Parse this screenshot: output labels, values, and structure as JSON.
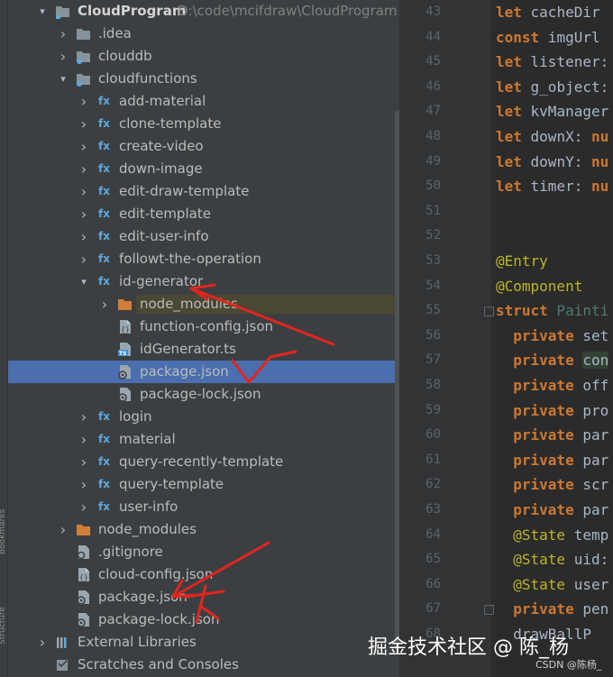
{
  "sidebar_stripe": {
    "labels": [
      "Bookmarks",
      "Structure"
    ]
  },
  "project": {
    "root": {
      "name": "CloudProgram",
      "path": "D:\\code\\mcifdraw\\CloudProgram"
    },
    "rows": [
      {
        "label": "CloudProgram",
        "depth": 0,
        "arrow": "open",
        "icon": "module-folder-icon"
      },
      {
        "label": ".idea",
        "depth": 1,
        "arrow": "closed",
        "icon": "folder-icon"
      },
      {
        "label": "clouddb",
        "depth": 1,
        "arrow": "closed",
        "icon": "db-folder-icon"
      },
      {
        "label": "cloudfunctions",
        "depth": 1,
        "arrow": "open",
        "icon": "db-folder-icon"
      },
      {
        "label": "add-material",
        "depth": 2,
        "arrow": "closed",
        "icon": "fx-icon"
      },
      {
        "label": "clone-template",
        "depth": 2,
        "arrow": "closed",
        "icon": "fx-icon"
      },
      {
        "label": "create-video",
        "depth": 2,
        "arrow": "closed",
        "icon": "fx-icon"
      },
      {
        "label": "down-image",
        "depth": 2,
        "arrow": "closed",
        "icon": "fx-icon"
      },
      {
        "label": "edit-draw-template",
        "depth": 2,
        "arrow": "closed",
        "icon": "fx-icon"
      },
      {
        "label": "edit-template",
        "depth": 2,
        "arrow": "closed",
        "icon": "fx-icon"
      },
      {
        "label": "edit-user-info",
        "depth": 2,
        "arrow": "closed",
        "icon": "fx-icon"
      },
      {
        "label": "followt-the-operation",
        "depth": 2,
        "arrow": "closed",
        "icon": "fx-icon"
      },
      {
        "label": "id-generator",
        "depth": 2,
        "arrow": "open",
        "icon": "fx-icon"
      },
      {
        "label": "node_modules",
        "depth": 3,
        "arrow": "closed",
        "icon": "orange-folder-icon",
        "highlight": true
      },
      {
        "label": "function-config.json",
        "depth": 3,
        "arrow": "none",
        "icon": "json-file-icon"
      },
      {
        "label": "idGenerator.ts",
        "depth": 3,
        "arrow": "none",
        "icon": "ts-file-icon"
      },
      {
        "label": "package.json",
        "depth": 3,
        "arrow": "none",
        "icon": "npm-file-icon",
        "selected": true
      },
      {
        "label": "package-lock.json",
        "depth": 3,
        "arrow": "none",
        "icon": "npm-file-icon"
      },
      {
        "label": "login",
        "depth": 2,
        "arrow": "closed",
        "icon": "fx-icon"
      },
      {
        "label": "material",
        "depth": 2,
        "arrow": "closed",
        "icon": "fx-icon"
      },
      {
        "label": "query-recently-template",
        "depth": 2,
        "arrow": "closed",
        "icon": "fx-icon"
      },
      {
        "label": "query-template",
        "depth": 2,
        "arrow": "closed",
        "icon": "fx-icon"
      },
      {
        "label": "user-info",
        "depth": 2,
        "arrow": "closed",
        "icon": "fx-icon"
      },
      {
        "label": "node_modules",
        "depth": 1,
        "arrow": "closed",
        "icon": "orange-folder-icon"
      },
      {
        "label": ".gitignore",
        "depth": 1,
        "arrow": "none",
        "icon": "text-file-icon"
      },
      {
        "label": "cloud-config.json",
        "depth": 1,
        "arrow": "none",
        "icon": "json-file-icon"
      },
      {
        "label": "package.json",
        "depth": 1,
        "arrow": "none",
        "icon": "npm-file-icon"
      },
      {
        "label": "package-lock.json",
        "depth": 1,
        "arrow": "none",
        "icon": "npm-file-icon"
      },
      {
        "label": "External Libraries",
        "depth": 0,
        "arrow": "closed",
        "icon": "libraries-icon"
      },
      {
        "label": "Scratches and Consoles",
        "depth": 0,
        "arrow": "none",
        "icon": "scratches-icon"
      }
    ]
  },
  "editor": {
    "lines": [
      {
        "n": "43",
        "parts": [
          [
            "kw",
            "let"
          ],
          [
            "plain",
            " cacheDir"
          ]
        ]
      },
      {
        "n": "44",
        "parts": [
          [
            "kw",
            "const"
          ],
          [
            "plain",
            " imgUrl"
          ]
        ]
      },
      {
        "n": "45",
        "parts": [
          [
            "kw",
            "let"
          ],
          [
            "plain",
            " listener:"
          ]
        ]
      },
      {
        "n": "46",
        "parts": [
          [
            "kw",
            "let"
          ],
          [
            "plain",
            " g_object:"
          ]
        ]
      },
      {
        "n": "47",
        "parts": [
          [
            "kw",
            "let"
          ],
          [
            "plain",
            " kvManager"
          ]
        ]
      },
      {
        "n": "48",
        "parts": [
          [
            "kw",
            "let"
          ],
          [
            "plain",
            " downX: "
          ],
          [
            "null",
            "nu"
          ]
        ]
      },
      {
        "n": "49",
        "parts": [
          [
            "kw",
            "let"
          ],
          [
            "plain",
            " downY: "
          ],
          [
            "null",
            "nu"
          ]
        ]
      },
      {
        "n": "50",
        "parts": [
          [
            "kw",
            "let"
          ],
          [
            "plain",
            " timer: "
          ],
          [
            "null",
            "nu"
          ]
        ]
      },
      {
        "n": "51",
        "parts": []
      },
      {
        "n": "52",
        "parts": []
      },
      {
        "n": "53",
        "parts": [
          [
            "deco",
            "@Entry"
          ]
        ]
      },
      {
        "n": "54",
        "parts": [
          [
            "deco",
            "@Component"
          ]
        ]
      },
      {
        "n": "55",
        "parts": [
          [
            "kw",
            "struct"
          ],
          [
            "cls",
            " Painti"
          ]
        ]
      },
      {
        "n": "56",
        "parts": [
          [
            "plain",
            "  "
          ],
          [
            "kw",
            "private"
          ],
          [
            "plain",
            " set"
          ]
        ]
      },
      {
        "n": "57",
        "parts": [
          [
            "plain",
            "  "
          ],
          [
            "kw",
            "private"
          ],
          [
            "plain",
            " "
          ],
          [
            "hl",
            "con"
          ]
        ]
      },
      {
        "n": "58",
        "parts": [
          [
            "plain",
            "  "
          ],
          [
            "kw",
            "private"
          ],
          [
            "plain",
            " off"
          ]
        ]
      },
      {
        "n": "59",
        "parts": [
          [
            "plain",
            "  "
          ],
          [
            "kw",
            "private"
          ],
          [
            "plain",
            " pro"
          ]
        ]
      },
      {
        "n": "60",
        "parts": [
          [
            "plain",
            "  "
          ],
          [
            "kw",
            "private"
          ],
          [
            "plain",
            " par"
          ]
        ]
      },
      {
        "n": "61",
        "parts": [
          [
            "plain",
            "  "
          ],
          [
            "kw",
            "private"
          ],
          [
            "plain",
            " par"
          ]
        ]
      },
      {
        "n": "62",
        "parts": [
          [
            "plain",
            "  "
          ],
          [
            "kw",
            "private"
          ],
          [
            "plain",
            " scr"
          ]
        ]
      },
      {
        "n": "63",
        "parts": [
          [
            "plain",
            "  "
          ],
          [
            "kw",
            "private"
          ],
          [
            "plain",
            " par"
          ]
        ]
      },
      {
        "n": "64",
        "parts": [
          [
            "plain",
            "  "
          ],
          [
            "deco",
            "@State"
          ],
          [
            "plain",
            " temp"
          ]
        ]
      },
      {
        "n": "65",
        "parts": [
          [
            "plain",
            "  "
          ],
          [
            "deco",
            "@State"
          ],
          [
            "plain",
            " uid:"
          ]
        ]
      },
      {
        "n": "66",
        "parts": [
          [
            "plain",
            "  "
          ],
          [
            "deco",
            "@State"
          ],
          [
            "plain",
            " user"
          ]
        ]
      },
      {
        "n": "67",
        "parts": [
          [
            "plain",
            "  "
          ],
          [
            "kw",
            "private"
          ],
          [
            "plain",
            " pen"
          ]
        ]
      },
      {
        "n": "68",
        "parts": [
          [
            "plain",
            "  drawBallP"
          ]
        ]
      }
    ]
  },
  "watermark": {
    "main": "掘金技术社区 @ 陈_杨",
    "sub": "CSDN @陈杨_"
  },
  "colors": {
    "selection": "#4b6eaf",
    "tree_bg": "#3c3f41",
    "editor_bg": "#2b2b2b",
    "keyword": "#cc7832",
    "annotation": "#bbb529",
    "annotation_marks": "#e0261f"
  }
}
